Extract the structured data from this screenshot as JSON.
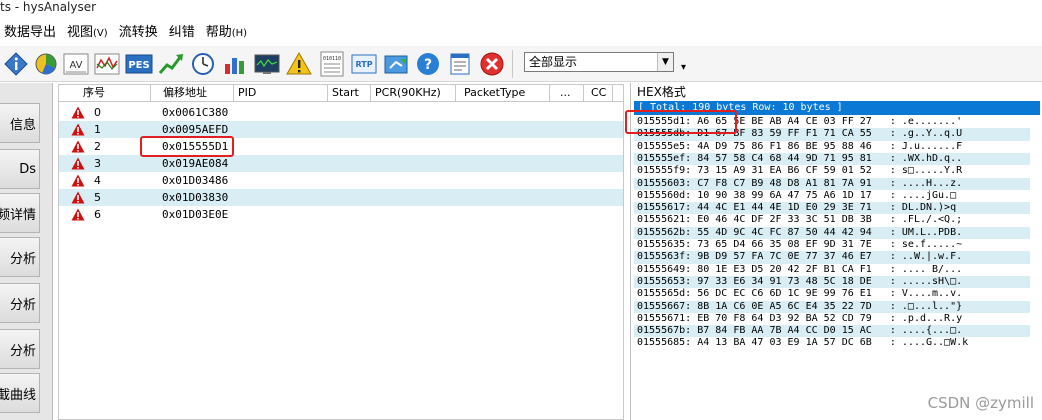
{
  "window": {
    "title": "ts - hysAnalyser"
  },
  "menu": [
    {
      "label": "数据导出",
      "accel": ""
    },
    {
      "label": "视图",
      "accel": "(V)"
    },
    {
      "label": "流转换",
      "accel": ""
    },
    {
      "label": "纠错",
      "accel": ""
    },
    {
      "label": "帮助",
      "accel": "(H)"
    }
  ],
  "toolbar": {
    "filter_value": "全部显示",
    "buttons": [
      {
        "name": "info-icon"
      },
      {
        "name": "pie-chart-icon"
      },
      {
        "name": "av-icon"
      },
      {
        "name": "waveform-icon"
      },
      {
        "name": "pes-icon"
      },
      {
        "name": "trend-up-icon"
      },
      {
        "name": "clock-icon"
      },
      {
        "name": "bar-chart-icon"
      },
      {
        "name": "monitor-icon"
      },
      {
        "name": "warning-icon"
      },
      {
        "name": "binary-icon"
      },
      {
        "name": "rtp-icon"
      },
      {
        "name": "export-icon"
      },
      {
        "name": "help-icon"
      },
      {
        "name": "notes-icon"
      },
      {
        "name": "close-icon"
      }
    ],
    "av_label": "AV",
    "pes_label": "PES",
    "rtp_label": "RTP",
    "binary_label": "010110"
  },
  "leftnav": [
    {
      "label": "信息"
    },
    {
      "label": "Ds"
    },
    {
      "label": "频详情"
    },
    {
      "label": "分析"
    },
    {
      "label": "分析"
    },
    {
      "label": "分析"
    },
    {
      "label": "截曲线"
    }
  ],
  "packet_table": {
    "columns": [
      "序号",
      "偏移地址",
      "PID",
      "Start",
      "PCR(90KHz)",
      "PacketType",
      "...",
      "CC"
    ],
    "rows": [
      {
        "index": "0",
        "offset": "0x0061C380"
      },
      {
        "index": "1",
        "offset": "0x0095AEFD"
      },
      {
        "index": "2",
        "offset": "0x015555D1"
      },
      {
        "index": "3",
        "offset": "0x019AE084"
      },
      {
        "index": "4",
        "offset": "0x01D03486"
      },
      {
        "index": "5",
        "offset": "0x01D03830"
      },
      {
        "index": "6",
        "offset": "0x01D03E0E"
      }
    ],
    "warning_color": "#d01010"
  },
  "hex_panel": {
    "title": "HEX格式",
    "summary": "[ Total: 190 bytes  Row: 10 bytes ]",
    "lines": [
      "015555d1: A6 65 5E BE AB A4 CE 03 FF 27   : .e.......'",
      "015555db: D1 67 BF 83 59 FF F1 71 CA 55   : .g..Y..q.U",
      "015555e5: 4A D9 75 86 F1 86 BE 95 88 46   : J.u......F",
      "015555ef: 84 57 58 C4 68 44 9D 71 95 81   : .WX.hD.q..",
      "015555f9: 73 15 A9 31 EA B6 CF 59 01 52   : s□.....Y.R",
      "01555603: C7 F8 C7 B9 48 D8 A1 81 7A 91   : ....H...z.",
      "0155560d: 10 90 38 99 6A 47 75 A6 1D 17   : ....jGu.□",
      "01555617: 44 4C E1 44 4E 1D E0 29 3E 71   : DL.DN.)>q",
      "01555621: E0 46 4C DF 2F 33 3C 51 DB 3B   : .FL./.<Q.;",
      "0155562b: 55 4D 9C 4C FC 87 50 44 42 94   : UM.L..PDB.",
      "01555635: 73 65 D4 66 35 08 EF 9D 31 7E   : se.f.....~",
      "0155563f: 9B D9 57 FA 7C 0E 77 37 46 E7   : ..W.|.w.F.",
      "01555649: 80 1E E3 D5 20 42 2F B1 CA F1   : .... B/...",
      "01555653: 97 33 E6 34 91 73 48 5C 18 DE   : .....sH\\□.",
      "0155565d: 56 DC EC C6 6D 1C 9E 99 76 E1   : V....m..v.",
      "01555667: 8B 1A C6 0E A5 6C E4 35 22 7D   : .□...l..\"}",
      "01555671: EB 70 F8 64 D3 92 BA 52 CD 79   : .p.d...R.y",
      "0155567b: B7 84 FB AA 7B A4 CC D0 15 AC   : ....{...□.",
      "01555685: A4 13 BA 47 03 E9 1A 57 DC 6B   : ....G..□W.k"
    ]
  },
  "watermark": "CSDN @zymill"
}
